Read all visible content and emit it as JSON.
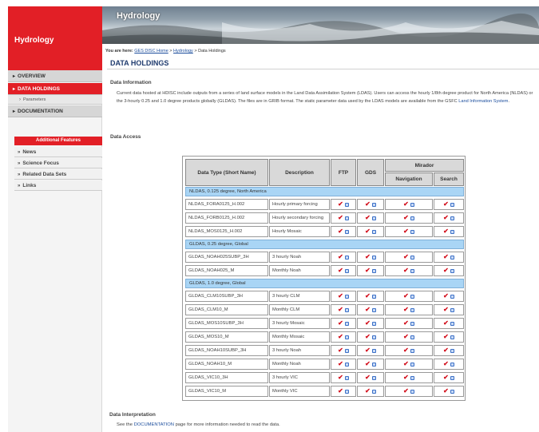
{
  "logo": {
    "title": "Hydrology"
  },
  "banner": {
    "title": "Hydrology"
  },
  "nav": {
    "items": [
      {
        "label": "Overview"
      },
      {
        "label": "Data Holdings"
      },
      {
        "label": "Documentation"
      }
    ],
    "sub_parameters": "Parameters"
  },
  "features": {
    "header": "Additional Features",
    "items": [
      {
        "label": "News"
      },
      {
        "label": "Science Focus"
      },
      {
        "label": "Related Data Sets"
      },
      {
        "label": "Links"
      }
    ]
  },
  "breadcrumb": {
    "prefix": "You are here:",
    "home": "GES DISC Home",
    "sep1": " > ",
    "hydrology": "Hydrology",
    "sep2": " > ",
    "current": "Data Holdings"
  },
  "page_title": "DATA HOLDINGS",
  "data_info": {
    "heading": "Data Information",
    "text_part1": "Current data hosted at HDISC include outputs from a series of land surface models in the Land Data Assimilation System (LDAS). Users can access the hourly 1/8th degree product for North America (NLDAS) or the 3-hourly 0.25 and 1.0 degree products globally (GLDAS). The files are in GRIB format. The static parameter data used by the LDAS models are available from the GSFC ",
    "link": "Land Information System",
    "text_part2": "."
  },
  "data_access": {
    "heading": "Data Access"
  },
  "table": {
    "headers": {
      "type": "Data Type (Short Name)",
      "desc": "Description",
      "ftp": "FTP",
      "gds": "GDS",
      "mirador": "Mirador",
      "navigation": "Navigation",
      "search": "Search"
    },
    "groups": [
      {
        "label": "NLDAS, 0.125 degree, North America",
        "rows": [
          {
            "name": "NLDAS_FORA0125_H.002",
            "desc": "Hourly primary forcing"
          },
          {
            "name": "NLDAS_FORB0125_H.002",
            "desc": "Hourly secondary forcing"
          },
          {
            "name": "NLDAS_MOS0125_H.002",
            "desc": "Hourly Mosaic"
          }
        ]
      },
      {
        "label": "GLDAS, 0.25 degree, Global",
        "rows": [
          {
            "name": "GLDAS_NOAH025SUBP_3H",
            "desc": "3 hourly Noah"
          },
          {
            "name": "GLDAS_NOAH025_M",
            "desc": "Monthly Noah"
          }
        ]
      },
      {
        "label": "GLDAS, 1.0 degree, Global",
        "rows": [
          {
            "name": "GLDAS_CLM10SUBP_3H",
            "desc": "3 hourly CLM"
          },
          {
            "name": "GLDAS_CLM10_M",
            "desc": "Monthly CLM"
          },
          {
            "name": "GLDAS_MOS10SUBP_3H",
            "desc": "3 hourly Mosaic"
          },
          {
            "name": "GLDAS_MOS10_M",
            "desc": "Monthly Mosaic"
          },
          {
            "name": "GLDAS_NOAH10SUBP_3H",
            "desc": "3 hourly Noah"
          },
          {
            "name": "GLDAS_NOAH10_M",
            "desc": "Monthly Noah"
          },
          {
            "name": "GLDAS_VIC10_3H",
            "desc": "3 hourly VIC"
          },
          {
            "name": "GLDAS_VIC10_M",
            "desc": "Monthly VIC"
          }
        ]
      }
    ]
  },
  "data_interp": {
    "heading": "Data Interpretation",
    "text_part1": "See the ",
    "link": "DOCUMENTATION",
    "text_part2": " page for more information needed to read the data."
  },
  "icons": {
    "check": "check-icon",
    "link": "link-icon",
    "bullet": "bullet-icon"
  },
  "colors": {
    "brand_red": "#e21f26",
    "title_blue": "#1f3b6e",
    "group_blue": "#a9d5f5",
    "link_blue": "#1a4c9c"
  }
}
